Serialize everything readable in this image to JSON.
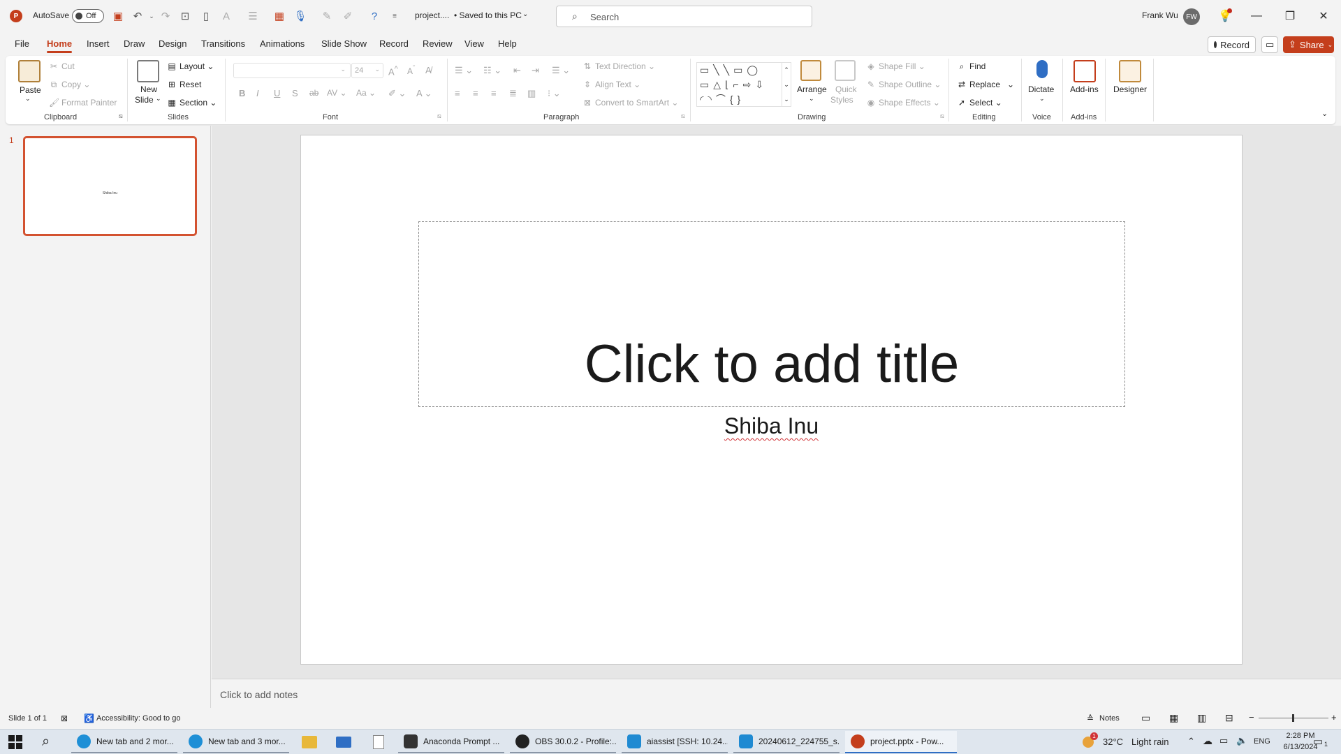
{
  "window": {
    "autosave_label": "AutoSave",
    "autosave_state": "Off",
    "doc_title": "project....",
    "save_state": "• Saved to this PC",
    "search_placeholder": "Search",
    "user_name": "Frank Wu",
    "user_initials": "FW"
  },
  "tabs": [
    "File",
    "Home",
    "Insert",
    "Draw",
    "Design",
    "Transitions",
    "Animations",
    "Slide Show",
    "Record",
    "Review",
    "View",
    "Help"
  ],
  "tab_actions": {
    "record": "Record",
    "share": "Share"
  },
  "ribbon": {
    "clipboard": {
      "paste": "Paste",
      "cut": "Cut",
      "copy": "Copy",
      "format_painter": "Format Painter",
      "group": "Clipboard"
    },
    "slides": {
      "new_slide_1": "New",
      "new_slide_2": "Slide",
      "layout": "Layout",
      "reset": "Reset",
      "section": "Section",
      "group": "Slides"
    },
    "font": {
      "size": "24",
      "group": "Font"
    },
    "paragraph": {
      "text_direction": "Text Direction",
      "align_text": "Align Text",
      "convert_smartart": "Convert to SmartArt",
      "group": "Paragraph"
    },
    "drawing": {
      "arrange": "Arrange",
      "quick_styles_1": "Quick",
      "quick_styles_2": "Styles",
      "shape_fill": "Shape Fill",
      "shape_outline": "Shape Outline",
      "shape_effects": "Shape Effects",
      "group": "Drawing"
    },
    "editing": {
      "find": "Find",
      "replace": "Replace",
      "select": "Select",
      "group": "Editing"
    },
    "voice": {
      "dictate": "Dictate",
      "group": "Voice"
    },
    "addins": {
      "addins": "Add-ins",
      "group": "Add-ins"
    },
    "designer": {
      "designer": "Designer"
    }
  },
  "slides_panel": {
    "slide_number": "1",
    "thumb_text": "Shiba Inu"
  },
  "slide": {
    "title_placeholder": "Click to add title",
    "subtitle": "Shiba Inu"
  },
  "notes": {
    "placeholder": "Click to add notes"
  },
  "status": {
    "slide_count": "Slide 1 of 1",
    "accessibility": "Accessibility: Good to go",
    "notes": "Notes"
  },
  "taskbar": {
    "items": [
      "New tab and 2 mor...",
      "New tab and 3 mor...",
      "Anaconda Prompt ...",
      "OBS 30.0.2 - Profile:...",
      "aiassist [SSH: 10.24....",
      "20240612_224755_s...",
      "project.pptx - Pow..."
    ],
    "weather_temp": "32°C",
    "weather_desc": "Light rain",
    "lang": "ENG",
    "time": "2:28 PM",
    "date": "6/13/2024",
    "notif_count": "1"
  },
  "colors": {
    "accent": "#c43e1c",
    "share": "#c43e1c",
    "thumb_border": "#d35230"
  }
}
